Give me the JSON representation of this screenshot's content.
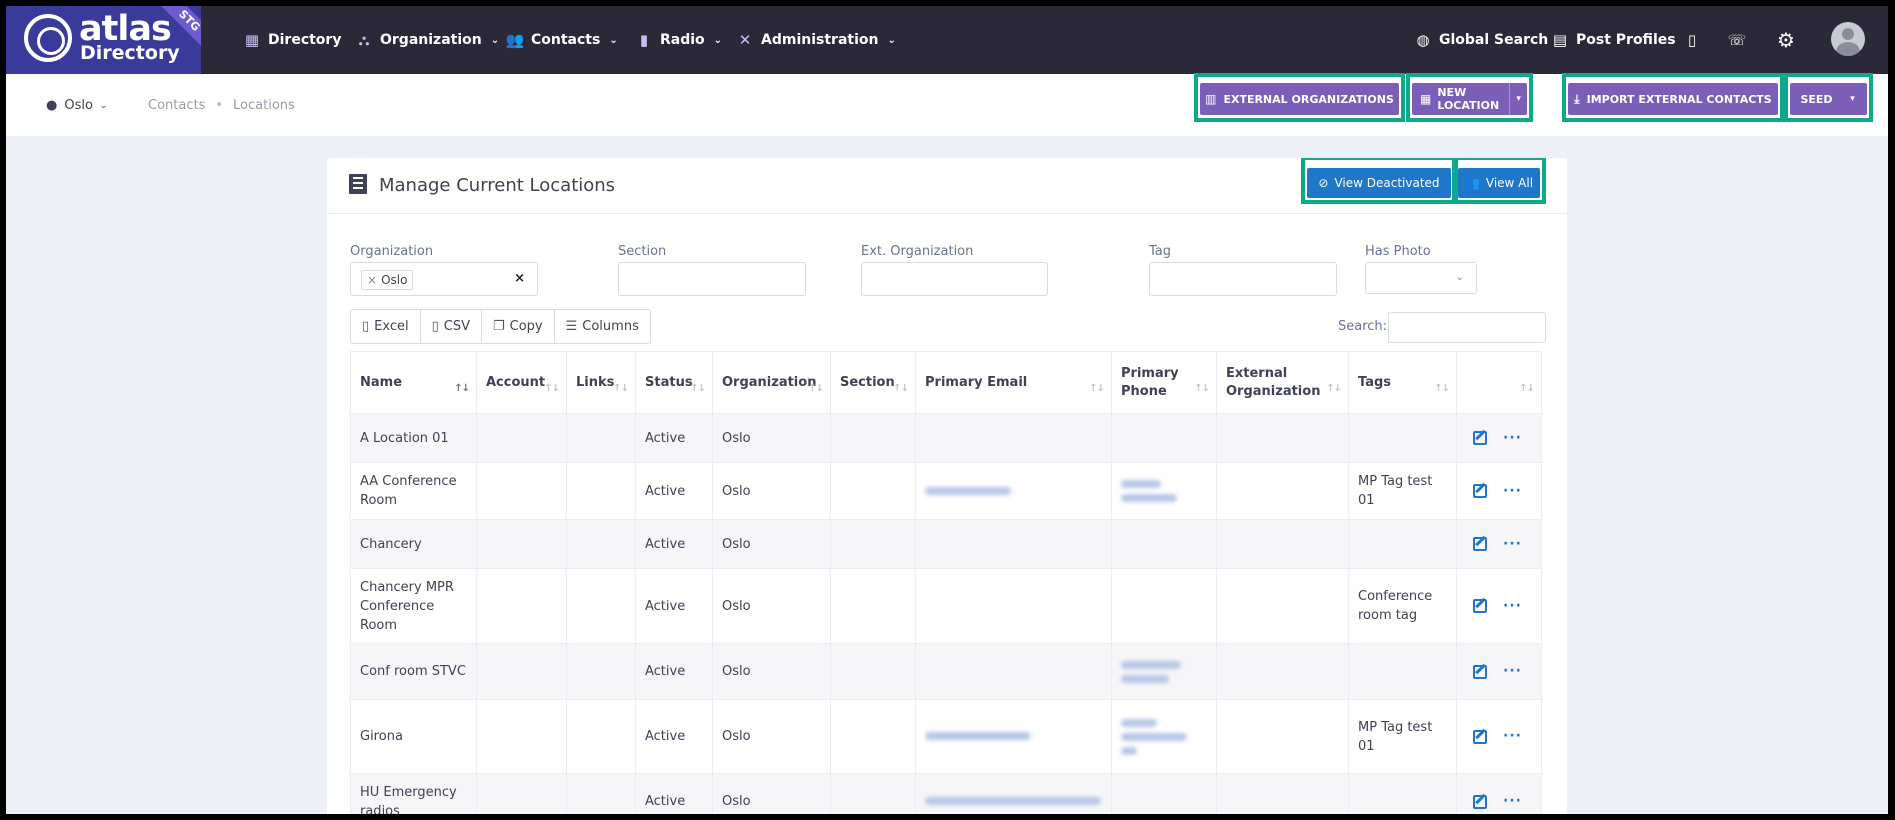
{
  "app": {
    "name": "atlas",
    "subtitle": "Directory",
    "env_badge": "STG"
  },
  "nav": {
    "items": [
      {
        "label": "Directory",
        "icon": "directory-icon"
      },
      {
        "label": "Organization",
        "icon": "org-chart-icon"
      },
      {
        "label": "Contacts",
        "icon": "users-icon"
      },
      {
        "label": "Radio",
        "icon": "radio-icon"
      },
      {
        "label": "Administration",
        "icon": "tools-icon"
      }
    ],
    "right": [
      {
        "label": "Global Search",
        "icon": "globe-icon"
      },
      {
        "label": "Post Profiles",
        "icon": "id-card-icon"
      }
    ]
  },
  "subheader": {
    "org": "Oslo",
    "breadcrumb": [
      "Contacts",
      "Locations"
    ],
    "buttons": {
      "external_orgs": "EXTERNAL ORGANIZATIONS",
      "new_location": "NEW LOCATION",
      "import_contacts": "IMPORT EXTERNAL CONTACTS",
      "seed": "SEED"
    }
  },
  "card": {
    "title": "Manage Current Locations",
    "view_deactivated": "View Deactivated",
    "view_all": "View All"
  },
  "filters": {
    "organization_label": "Organization",
    "organization_value": "Oslo",
    "section_label": "Section",
    "ext_org_label": "Ext. Organization",
    "tag_label": "Tag",
    "has_photo_label": "Has Photo"
  },
  "toolbar": {
    "excel": "Excel",
    "csv": "CSV",
    "copy": "Copy",
    "columns": "Columns",
    "search_label": "Search:"
  },
  "table": {
    "headers": [
      "Name",
      "Account",
      "Links",
      "Status",
      "Organization",
      "Section",
      "Primary Email",
      "Primary Phone",
      "External Organization",
      "Tags",
      ""
    ],
    "rows": [
      {
        "name": "A Location 01",
        "status": "Active",
        "org": "Oslo",
        "tags": ""
      },
      {
        "name": "AA Conference Room",
        "status": "Active",
        "org": "Oslo",
        "tags": "MP Tag test 01"
      },
      {
        "name": "Chancery",
        "status": "Active",
        "org": "Oslo",
        "tags": ""
      },
      {
        "name": "Chancery MPR Conference Room",
        "status": "Active",
        "org": "Oslo",
        "tags": "Conference room tag"
      },
      {
        "name": "Conf room STVC",
        "status": "Active",
        "org": "Oslo",
        "tags": ""
      },
      {
        "name": "Girona",
        "status": "Active",
        "org": "Oslo",
        "tags": "MP Tag test 01"
      },
      {
        "name": "HU Emergency radios",
        "status": "Active",
        "org": "Oslo",
        "tags": ""
      }
    ]
  },
  "colors": {
    "navbar": "#2b2938",
    "purple_button": "#7b5eb7",
    "blue_button": "#1f77c9",
    "highlight": "#10a88a"
  }
}
